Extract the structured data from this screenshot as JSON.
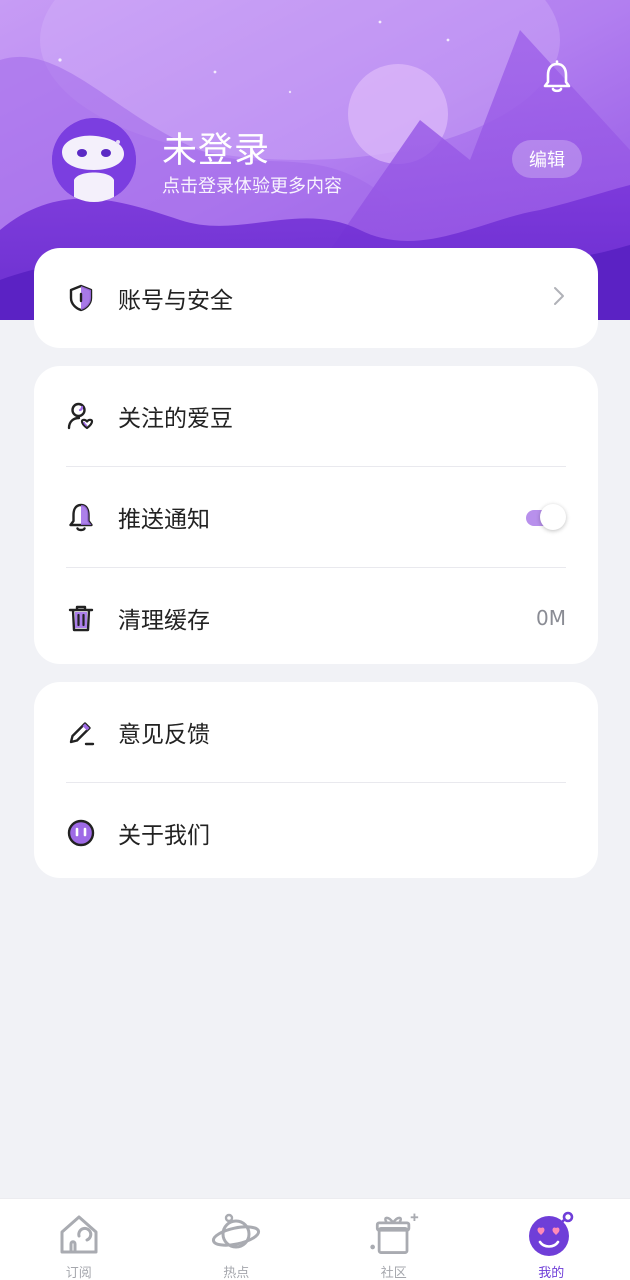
{
  "header": {
    "username": "未登录",
    "subtitle": "点击登录体验更多内容",
    "edit_label": "编辑"
  },
  "icons": {
    "notification": "bell-icon",
    "avatar": "robot-avatar"
  },
  "groups": [
    {
      "items": [
        {
          "icon": "shield-icon",
          "label": "账号与安全",
          "right": "chevron-right-icon"
        }
      ]
    },
    {
      "items": [
        {
          "icon": "user-heart-icon",
          "label": "关注的爱豆"
        },
        {
          "icon": "bell-icon",
          "label": "推送通知",
          "toggle_on": true
        },
        {
          "icon": "trash-icon",
          "label": "清理缓存",
          "value": "0M"
        }
      ]
    },
    {
      "items": [
        {
          "icon": "pencil-icon",
          "label": "意见反馈"
        },
        {
          "icon": "smile-face-icon",
          "label": "关于我们"
        }
      ]
    }
  ],
  "tabbar": {
    "tabs": [
      {
        "icon": "house-icon",
        "label": "订阅",
        "active": false
      },
      {
        "icon": "planet-icon",
        "label": "热点",
        "active": false
      },
      {
        "icon": "gift-box-icon",
        "label": "社区",
        "active": false
      },
      {
        "icon": "face-hearts-icon",
        "label": "我的",
        "active": true
      }
    ]
  },
  "colors": {
    "accent": "#6f3ed8",
    "header_gradient_start": "#b98af0",
    "header_gradient_end": "#7a35d9",
    "background": "#f1f2f6",
    "toggle_track": "#b890ec"
  }
}
